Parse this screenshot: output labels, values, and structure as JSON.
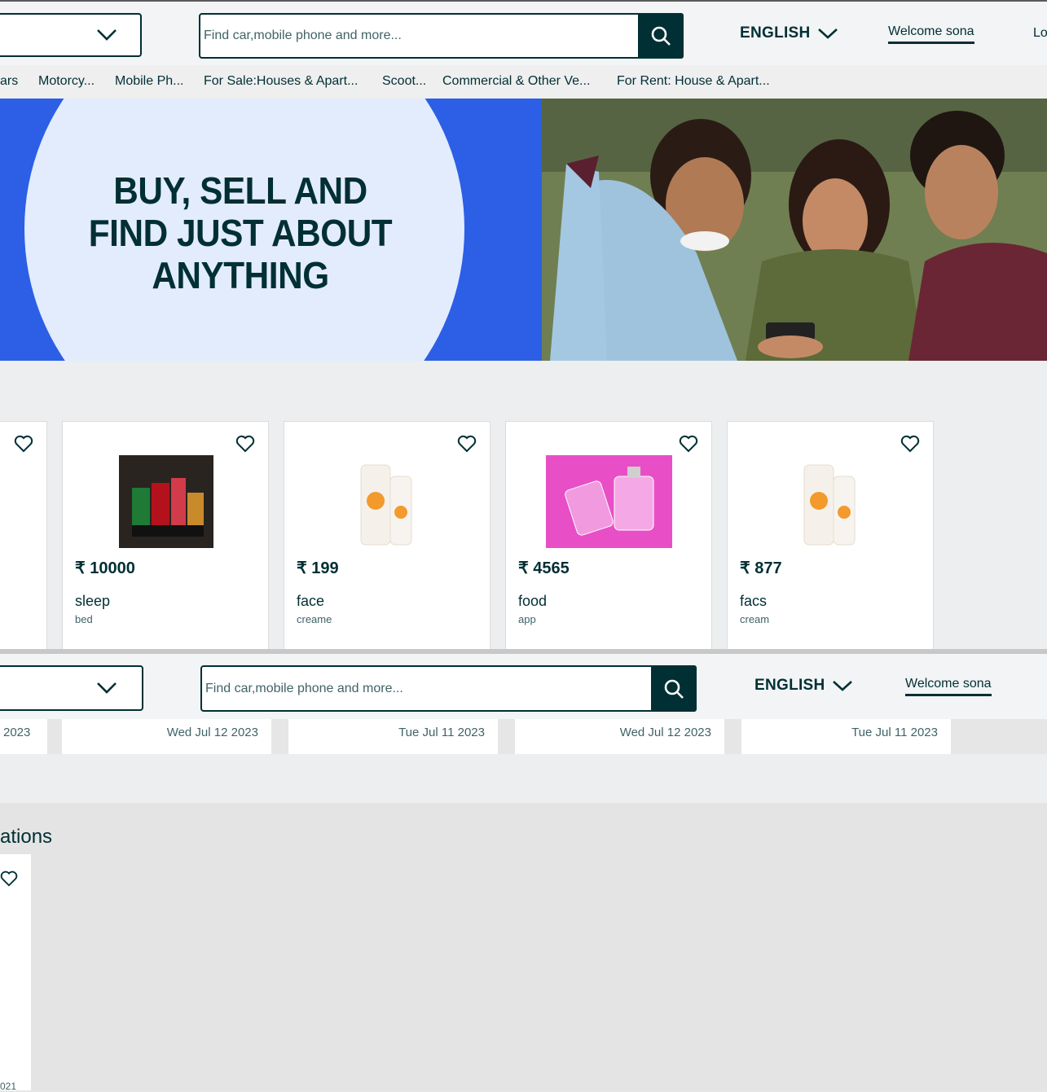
{
  "header": {
    "search_placeholder": "Find car,mobile phone and more...",
    "language": "ENGLISH",
    "welcome": "Welcome sona",
    "login_partial": "Lo"
  },
  "categories": [
    "ars",
    "Motorcy...",
    "Mobile Ph...",
    "For Sale:Houses & Apart...",
    "Scoot...",
    "Commercial & Other Ve...",
    "For Rent: House & Apart..."
  ],
  "banner": {
    "line1": "BUY, SELL AND",
    "line2": "FIND JUST ABOUT",
    "line3": "ANYTHING",
    "bg_color": "#2c5fe6",
    "circle_color": "#e3ecfd"
  },
  "listings": [
    {
      "price": "₹ 10000",
      "title": "sleep",
      "subtitle": "bed",
      "date": "Wed Jul 12 2023"
    },
    {
      "price": "₹ 199",
      "title": "face",
      "subtitle": "creame",
      "date": "Tue Jul 11 2023"
    },
    {
      "price": "₹ 4565",
      "title": "food",
      "subtitle": "app",
      "date": "Wed Jul 12 2023"
    },
    {
      "price": "₹ 877",
      "title": "facs",
      "subtitle": "cream",
      "date": "Tue Jul 11 2023"
    }
  ],
  "partial_dates": {
    "left_card": "2023",
    "bottom_left": "021"
  },
  "section_title_partial": "ations",
  "colors": {
    "brand": "#002f34",
    "accent_blue": "#2c5fe6"
  }
}
